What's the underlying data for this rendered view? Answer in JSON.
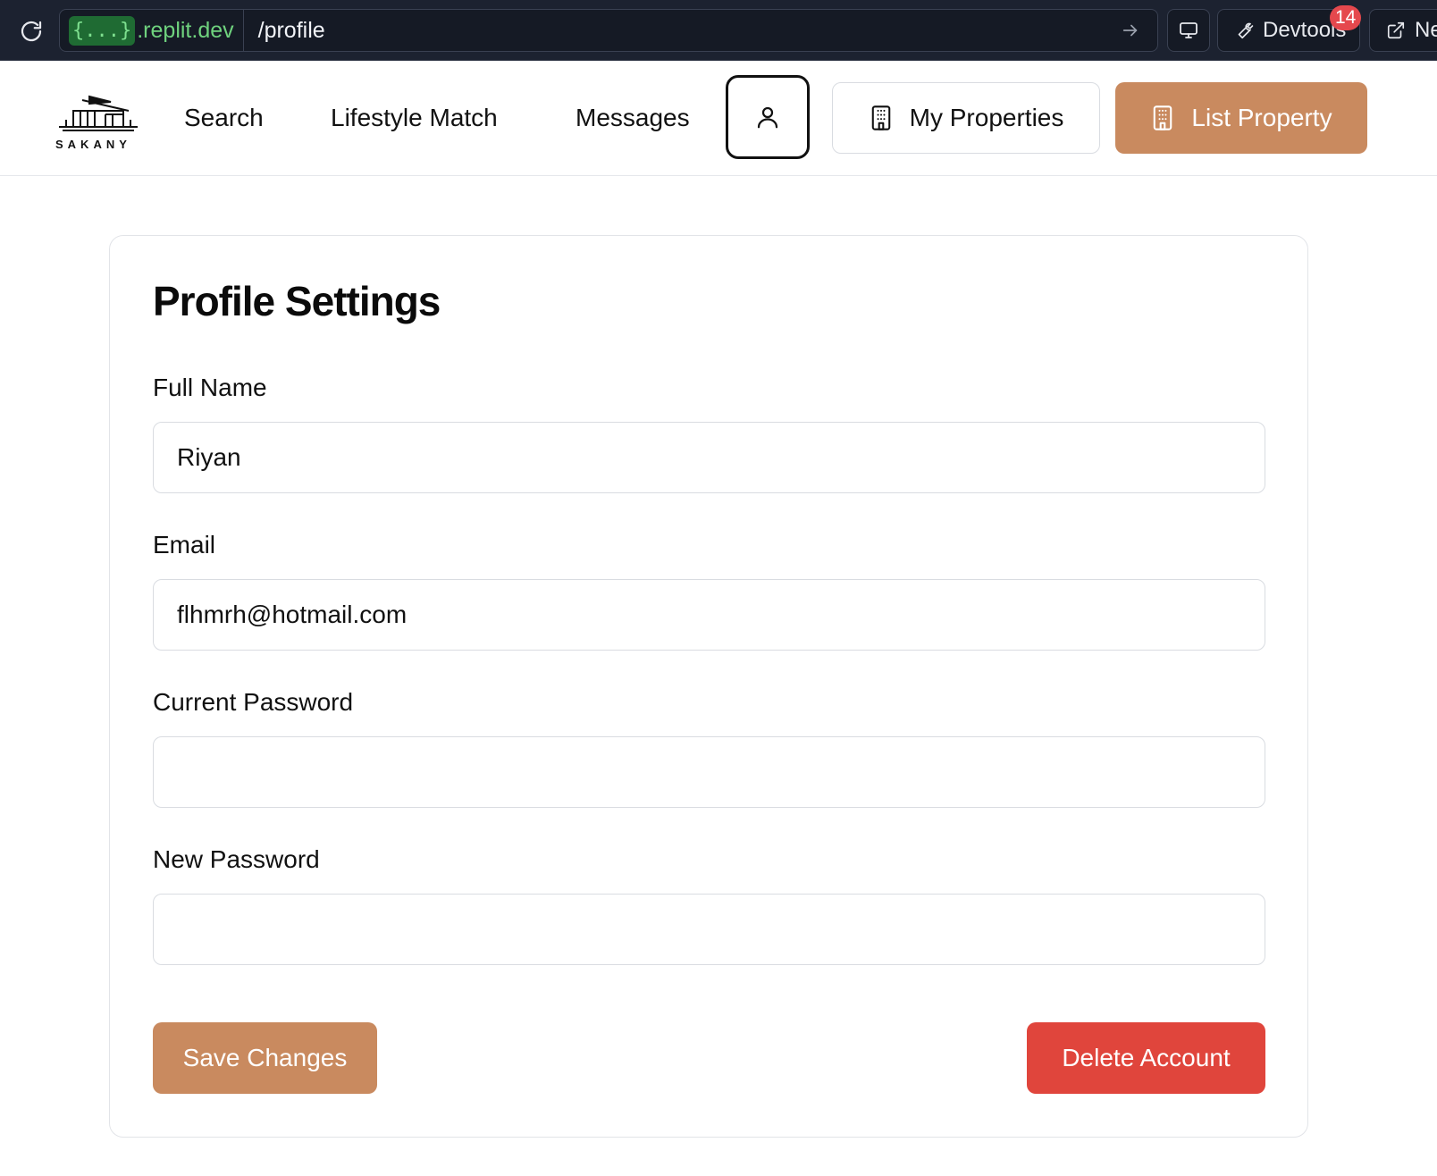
{
  "browser": {
    "url_chip": "{...}",
    "url_host": ".replit.dev",
    "url_path": "/profile",
    "devtools_label": "Devtools",
    "devtools_badge": "14",
    "new_tab_label": "Ne"
  },
  "header": {
    "logo_text": "SAKANY",
    "nav": {
      "search": "Search",
      "lifestyle": "Lifestyle Match",
      "messages": "Messages"
    },
    "my_properties": "My Properties",
    "list_property": "List Property",
    "icons": {
      "profile": "user-icon",
      "building": "building-icon"
    }
  },
  "profile": {
    "title": "Profile Settings",
    "full_name_label": "Full Name",
    "full_name_value": "Riyan",
    "email_label": "Email",
    "email_value": "flhmrh@hotmail.com",
    "current_password_label": "Current Password",
    "current_password_value": "",
    "new_password_label": "New Password",
    "new_password_value": "",
    "save_label": "Save Changes",
    "delete_label": "Delete Account"
  },
  "colors": {
    "accent": "#c98a5f",
    "danger": "#e0453c",
    "browser_bg": "#1c2230"
  }
}
